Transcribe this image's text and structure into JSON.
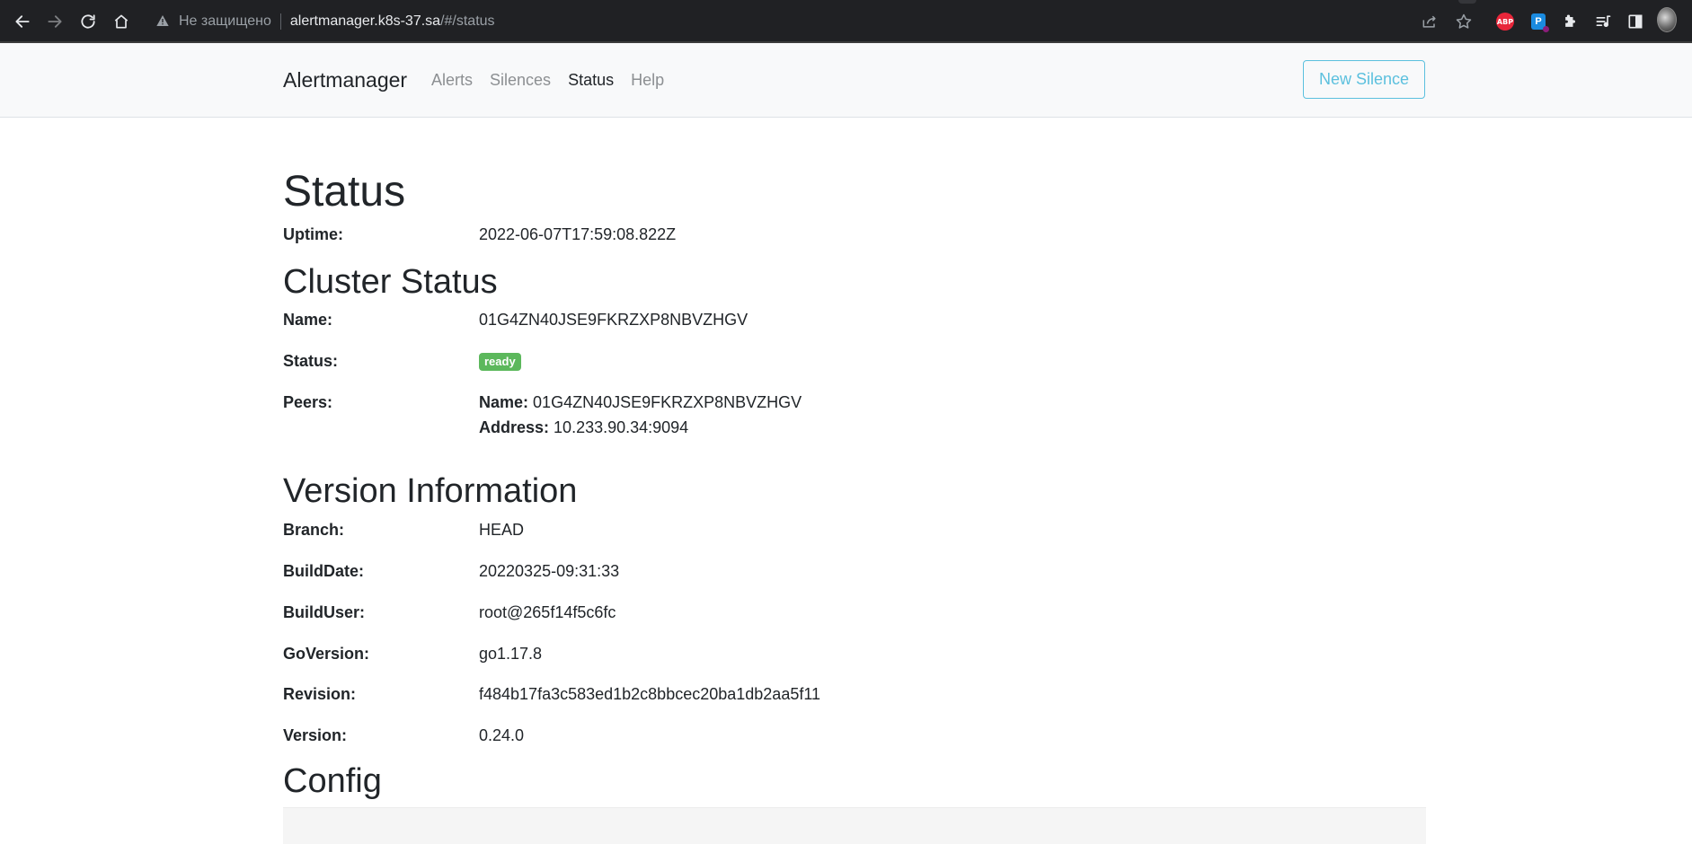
{
  "browser": {
    "insecure_label": "Не защищено",
    "url_host": "alertmanager.k8s-37.sa",
    "url_path": "/#/status",
    "abp_label": "ABP",
    "blue_ext_label": "P"
  },
  "navbar": {
    "brand": "Alertmanager",
    "links": [
      "Alerts",
      "Silences",
      "Status",
      "Help"
    ],
    "active_link": "Status",
    "new_silence": "New Silence"
  },
  "status": {
    "title": "Status",
    "uptime_label": "Uptime:",
    "uptime_value": "2022-06-07T17:59:08.822Z"
  },
  "cluster": {
    "title": "Cluster Status",
    "name_label": "Name:",
    "name_value": "01G4ZN40JSE9FKRZXP8NBVZHGV",
    "status_label": "Status:",
    "status_badge": "ready",
    "peers_label": "Peers:",
    "peer_name_label": "Name:",
    "peer_name_value": "01G4ZN40JSE9FKRZXP8NBVZHGV",
    "peer_address_label": "Address:",
    "peer_address_value": "10.233.90.34:9094"
  },
  "version": {
    "title": "Version Information",
    "rows": [
      {
        "label": "Branch:",
        "value": "HEAD"
      },
      {
        "label": "BuildDate:",
        "value": "20220325-09:31:33"
      },
      {
        "label": "BuildUser:",
        "value": "root@265f14f5c6fc"
      },
      {
        "label": "GoVersion:",
        "value": "go1.17.8"
      },
      {
        "label": "Revision:",
        "value": "f484b17fa3c583ed1b2c8bbcec20ba1db2aa5f11"
      },
      {
        "label": "Version:",
        "value": "0.24.0"
      }
    ]
  },
  "config": {
    "title": "Config"
  },
  "colors": {
    "badge_success": "#5cb85c",
    "button_info": "#5bc0de",
    "navbar_bg": "#f8f9fa",
    "chrome_bg": "#202124"
  }
}
